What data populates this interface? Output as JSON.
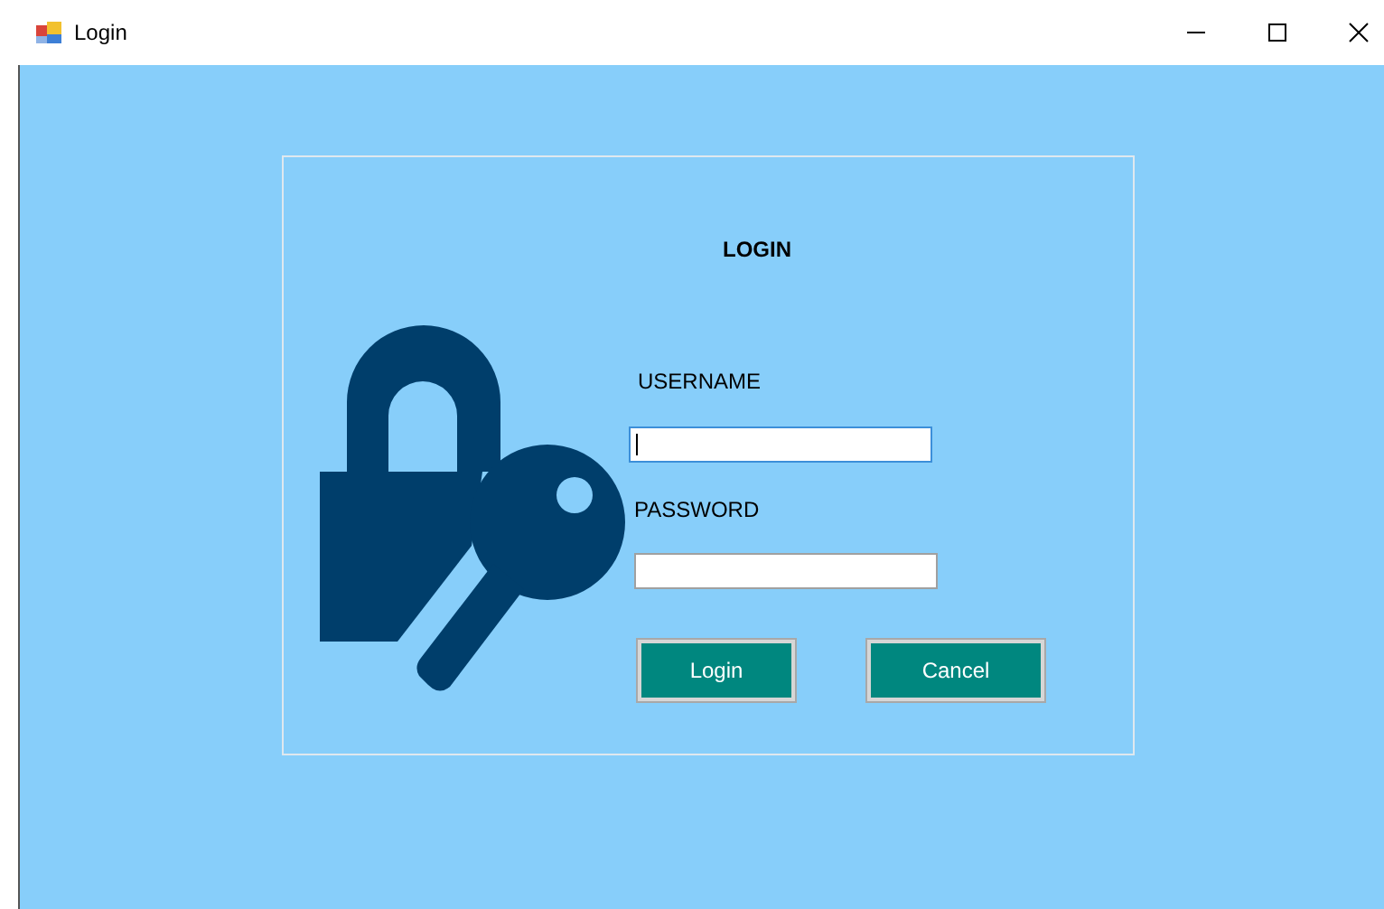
{
  "window": {
    "title": "Login"
  },
  "form": {
    "title": "LOGIN",
    "fields": [
      {
        "label": "USERNAME",
        "focused": true
      },
      {
        "label": "PASSWORD",
        "focused": false
      }
    ],
    "buttons": [
      "Login",
      "Cancel"
    ]
  }
}
